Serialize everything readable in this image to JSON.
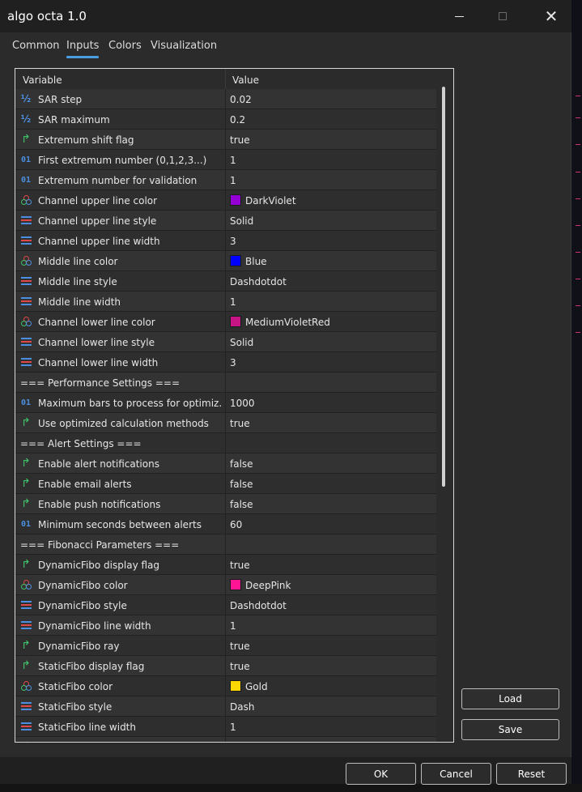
{
  "window": {
    "title": "algo octa 1.0"
  },
  "tabs": [
    {
      "label": "Common"
    },
    {
      "label": "Inputs"
    },
    {
      "label": "Colors"
    },
    {
      "label": "Visualization"
    }
  ],
  "active_tab": "Inputs",
  "grid": {
    "columns": [
      "Variable",
      "Value"
    ],
    "rows": [
      {
        "icon": "fraction-icon",
        "name": "SAR step",
        "value": "0.02"
      },
      {
        "icon": "fraction-icon",
        "name": "SAR maximum",
        "value": "0.2"
      },
      {
        "icon": "bool-arrow-icon",
        "name": "Extremum shift flag",
        "value": "true"
      },
      {
        "icon": "integer-icon",
        "name": "First extremum number (0,1,2,3...)",
        "value": "1"
      },
      {
        "icon": "integer-icon",
        "name": "Extremum number for validation",
        "value": "1"
      },
      {
        "icon": "color-circles-icon",
        "name": "Channel upper line color",
        "value": "DarkViolet",
        "swatch": "#9400d3"
      },
      {
        "icon": "line-style-icon",
        "name": "Channel upper line style",
        "value": "Solid"
      },
      {
        "icon": "line-style-icon",
        "name": "Channel upper line width",
        "value": "3"
      },
      {
        "icon": "color-circles-icon",
        "name": "Middle line color",
        "value": "Blue",
        "swatch": "#0000ff"
      },
      {
        "icon": "line-style-icon",
        "name": "Middle line style",
        "value": "Dashdotdot"
      },
      {
        "icon": "line-style-icon",
        "name": "Middle line width",
        "value": "1"
      },
      {
        "icon": "color-circles-icon",
        "name": "Channel lower line color",
        "value": "MediumVioletRed",
        "swatch": "#c71585"
      },
      {
        "icon": "line-style-icon",
        "name": "Channel lower line style",
        "value": "Solid"
      },
      {
        "icon": "line-style-icon",
        "name": "Channel lower line width",
        "value": "3"
      },
      {
        "section": true,
        "name": "=== Performance Settings ===",
        "value": ""
      },
      {
        "icon": "integer-icon",
        "name": "Maximum bars to process for optimiz...",
        "value": "1000"
      },
      {
        "icon": "bool-arrow-icon",
        "name": "Use optimized calculation methods",
        "value": "true"
      },
      {
        "section": true,
        "name": "=== Alert Settings ===",
        "value": ""
      },
      {
        "icon": "bool-arrow-icon",
        "name": "Enable alert notifications",
        "value": "false"
      },
      {
        "icon": "bool-arrow-icon",
        "name": "Enable email alerts",
        "value": "false"
      },
      {
        "icon": "bool-arrow-icon",
        "name": "Enable push notifications",
        "value": "false"
      },
      {
        "icon": "integer-icon",
        "name": "Minimum seconds between alerts",
        "value": "60"
      },
      {
        "section": true,
        "name": "=== Fibonacci Parameters ===",
        "value": ""
      },
      {
        "icon": "bool-arrow-icon",
        "name": "DynamicFibo display flag",
        "value": "true"
      },
      {
        "icon": "color-circles-icon",
        "name": "DynamicFibo color",
        "value": "DeepPink",
        "swatch": "#ff1493"
      },
      {
        "icon": "line-style-icon",
        "name": "DynamicFibo style",
        "value": "Dashdotdot"
      },
      {
        "icon": "line-style-icon",
        "name": "DynamicFibo line width",
        "value": "1"
      },
      {
        "icon": "bool-arrow-icon",
        "name": "DynamicFibo ray",
        "value": "true"
      },
      {
        "icon": "bool-arrow-icon",
        "name": "StaticFibo display flag",
        "value": "true"
      },
      {
        "icon": "color-circles-icon",
        "name": "StaticFibo color",
        "value": "Gold",
        "swatch": "#ffd700"
      },
      {
        "icon": "line-style-icon",
        "name": "StaticFibo style",
        "value": "Dash"
      },
      {
        "icon": "line-style-icon",
        "name": "StaticFibo line width",
        "value": "1"
      },
      {
        "icon": "bool-arrow-icon",
        "name": "",
        "value": ""
      }
    ]
  },
  "buttons": {
    "load": "Load",
    "save": "Save",
    "ok": "OK",
    "cancel": "Cancel",
    "reset": "Reset"
  },
  "colors": {
    "accent": "#4a9de0",
    "chart_tick": "#d0307a"
  }
}
